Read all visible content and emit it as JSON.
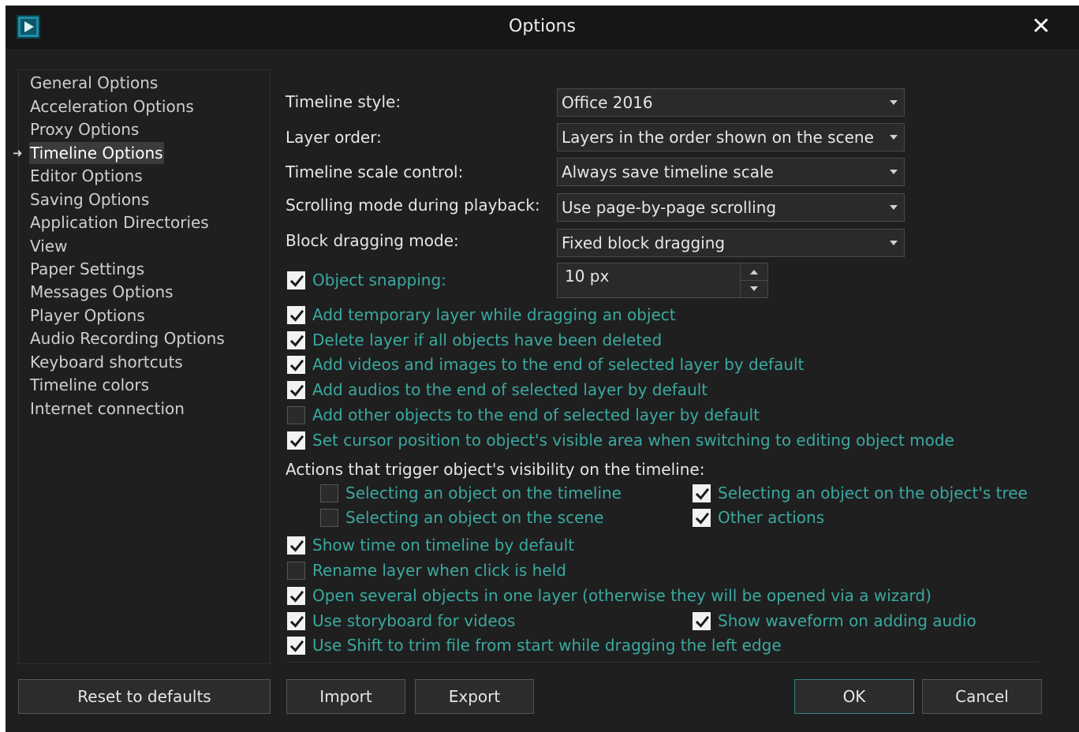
{
  "window": {
    "title": "Options"
  },
  "sidebar": {
    "items": [
      {
        "label": "General Options",
        "active": false
      },
      {
        "label": "Acceleration Options",
        "active": false
      },
      {
        "label": "Proxy Options",
        "active": false
      },
      {
        "label": "Timeline Options",
        "active": true
      },
      {
        "label": "Editor Options",
        "active": false
      },
      {
        "label": "Saving Options",
        "active": false
      },
      {
        "label": "Application Directories",
        "active": false
      },
      {
        "label": "View",
        "active": false
      },
      {
        "label": "Paper Settings",
        "active": false
      },
      {
        "label": "Messages Options",
        "active": false
      },
      {
        "label": "Player Options",
        "active": false
      },
      {
        "label": "Audio Recording Options",
        "active": false
      },
      {
        "label": "Keyboard shortcuts",
        "active": false
      },
      {
        "label": "Timeline colors",
        "active": false
      },
      {
        "label": "Internet connection",
        "active": false
      }
    ]
  },
  "settings": {
    "timeline_style": {
      "label": "Timeline style:",
      "value": "Office 2016"
    },
    "layer_order": {
      "label": "Layer order:",
      "value": "Layers in the order shown on the scene"
    },
    "scale_control": {
      "label": "Timeline scale control:",
      "value": "Always save timeline scale"
    },
    "scrolling_mode": {
      "label": "Scrolling mode during playback:",
      "value": "Use page-by-page scrolling"
    },
    "block_dragging": {
      "label": "Block dragging mode:",
      "value": "Fixed block dragging"
    },
    "object_snapping": {
      "label": "Object snapping:",
      "checked": true,
      "value": "10 px"
    }
  },
  "checkboxes": [
    {
      "label": "Add temporary layer while dragging an object",
      "checked": true
    },
    {
      "label": "Delete layer if all objects have been deleted",
      "checked": true
    },
    {
      "label": "Add videos and images to the end of selected layer by default",
      "checked": true
    },
    {
      "label": "Add audios to the end of selected layer by default",
      "checked": true
    },
    {
      "label": "Add other objects to the end of selected layer by default",
      "checked": false
    },
    {
      "label": "Set cursor position to object's visible area when switching to editing object mode",
      "checked": true
    }
  ],
  "visibility": {
    "heading": "Actions that trigger object's visibility on the timeline:",
    "options": [
      {
        "label": "Selecting an object on the timeline",
        "checked": false
      },
      {
        "label": "Selecting an object on the object's tree",
        "checked": true
      },
      {
        "label": "Selecting an object on the scene",
        "checked": false
      },
      {
        "label": "Other actions",
        "checked": true
      }
    ]
  },
  "more_checkboxes": [
    {
      "label": "Show time on timeline by default",
      "checked": true
    },
    {
      "label": "Rename layer when click is held",
      "checked": false
    },
    {
      "label": "Open several objects in one layer (otherwise they will be opened via a wizard)",
      "checked": true
    },
    {
      "label": "Use storyboard for videos",
      "checked": true
    },
    {
      "label": "Show waveform on adding audio",
      "checked": true
    },
    {
      "label": "Use Shift to trim file from start while dragging the left edge",
      "checked": true
    }
  ],
  "buttons": {
    "reset": "Reset to defaults",
    "import": "Import",
    "export": "Export",
    "ok": "OK",
    "cancel": "Cancel"
  },
  "colors": {
    "background": "#1f1f1f",
    "titlebar": "#161616",
    "checkbox_label": "#3aa9a0",
    "text": "#e6e6e6"
  }
}
